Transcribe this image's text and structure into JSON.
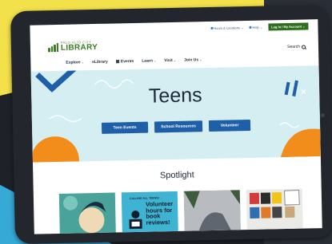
{
  "topbar": {
    "hours_label": "Hours & Locations",
    "help_label": "Help",
    "login_label": "Log In / My Account"
  },
  "logo": {
    "small": "PALO ALTO CITY",
    "big": "LIBRARY"
  },
  "search_label": "Search",
  "nav": [
    {
      "label": "Explore",
      "caret": "⌄"
    },
    {
      "label": "eLibrary",
      "caret": ""
    },
    {
      "label": "Events",
      "caret": ""
    },
    {
      "label": "Learn",
      "caret": "⌄"
    },
    {
      "label": "Visit",
      "caret": "⌄"
    },
    {
      "label": "Join Us",
      "caret": "⌄"
    }
  ],
  "hero": {
    "title": "Teens",
    "buttons": [
      "Teen Events",
      "School Resources",
      "Volunteer"
    ]
  },
  "spotlight": {
    "title": "Spotlight",
    "card2_small": "CALLING ALL TEENS!",
    "card2_big": "Volunteer hours for book reviews!"
  },
  "colors": {
    "brand_green": "#3a7d22",
    "button_blue": "#1e5fa8",
    "hero_bg": "#d5eef2",
    "accent_orange": "#f28c1a"
  }
}
